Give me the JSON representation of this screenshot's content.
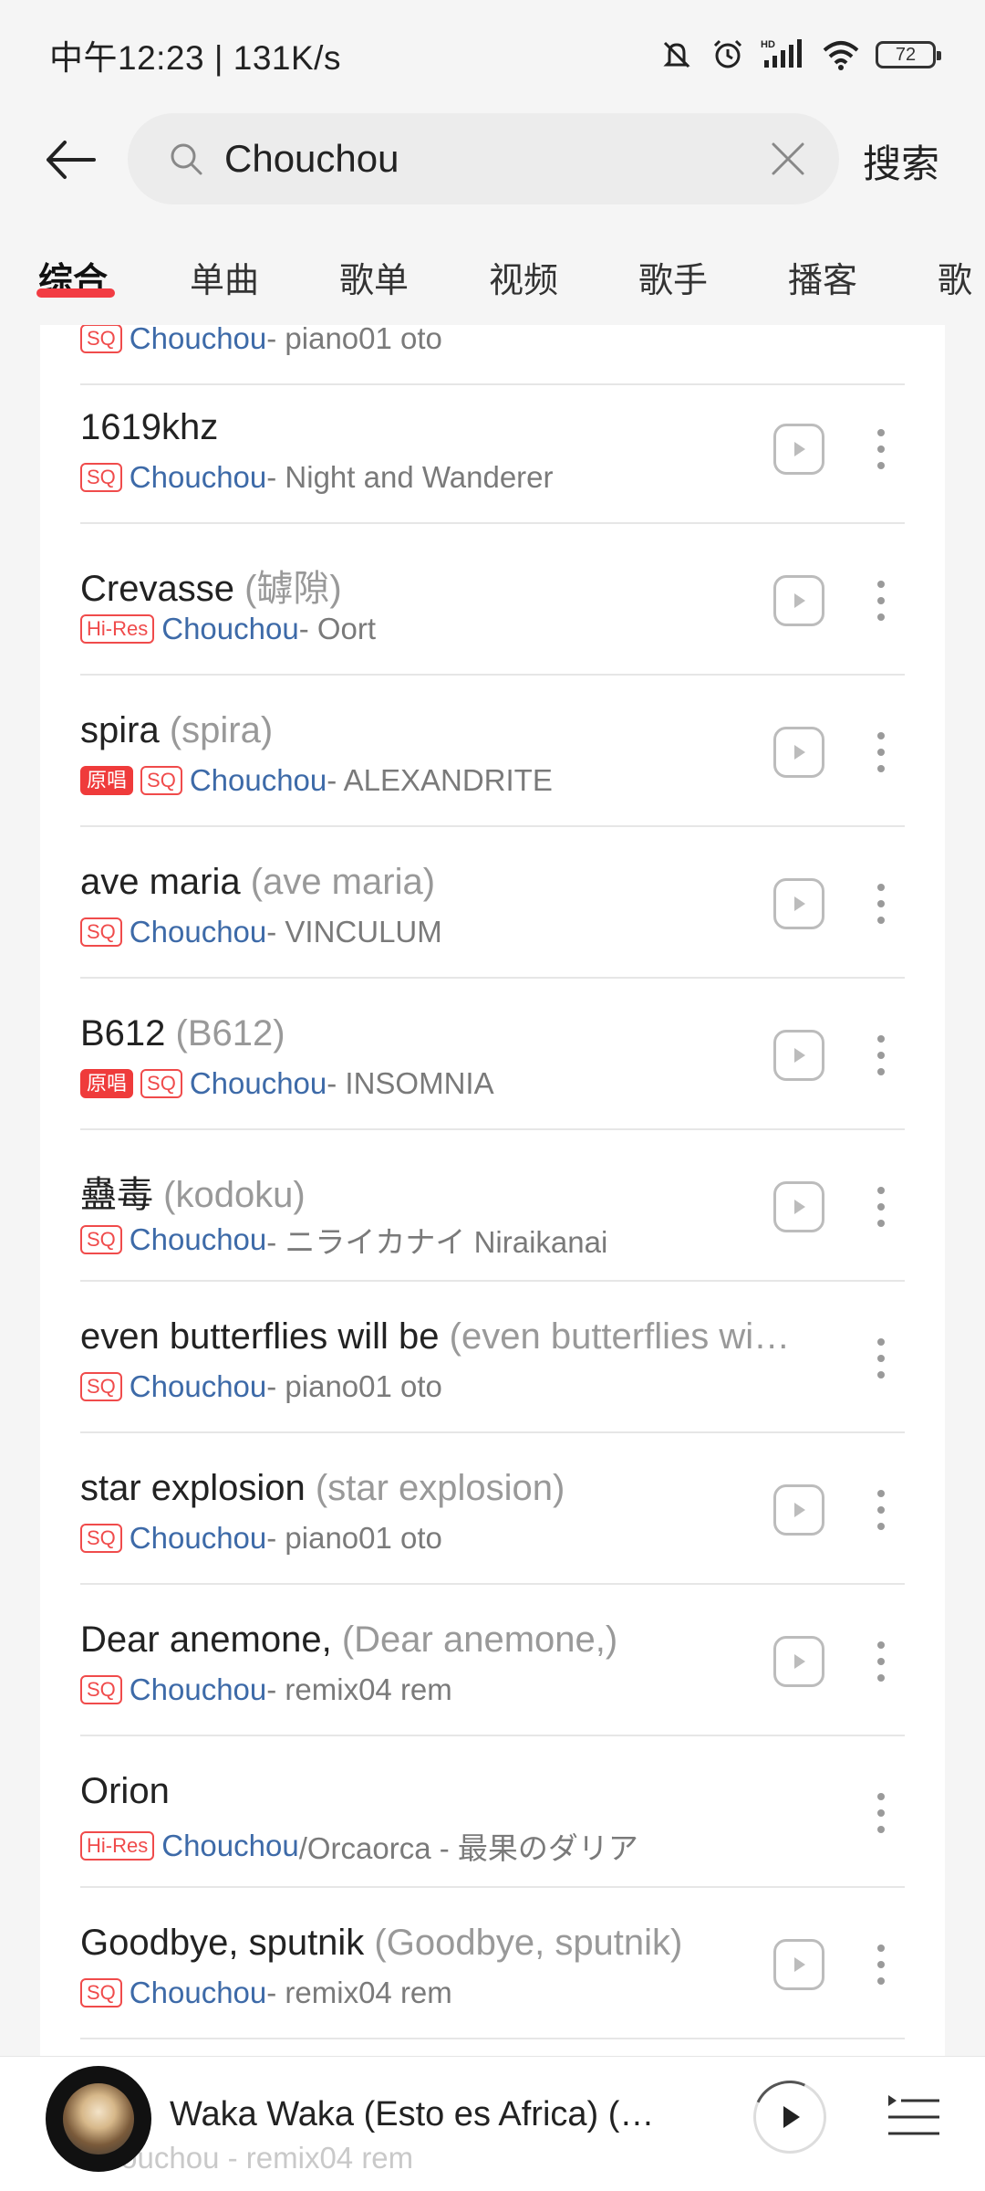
{
  "status_bar": {
    "time_speed": "中午12:23 | 131K/s",
    "battery": "72",
    "icons": [
      "mute-icon",
      "alarm-icon",
      "hd-signal-icon",
      "wifi-icon",
      "battery-icon"
    ]
  },
  "search": {
    "query": "Chouchou",
    "action_label": "搜索"
  },
  "tabs": [
    {
      "label": "综合",
      "active": true
    },
    {
      "label": "单曲",
      "active": false
    },
    {
      "label": "歌单",
      "active": false
    },
    {
      "label": "视频",
      "active": false
    },
    {
      "label": "歌手",
      "active": false
    },
    {
      "label": "播客",
      "active": false
    },
    {
      "label": "歌",
      "active": false
    }
  ],
  "partial_top_row": {
    "badge": "SQ",
    "artist": "Chouchou",
    "album": " - piano01 oto"
  },
  "songs": [
    {
      "title": "1619khz",
      "alias": "",
      "badges": [
        "SQ"
      ],
      "artist": "Chouchou",
      "album": " - Night and Wanderer",
      "has_play": true
    },
    {
      "title": "Crevasse ",
      "alias": "(罅隙)",
      "badges": [
        "Hi-Res"
      ],
      "artist": "Chouchou",
      "album": " - Oort",
      "has_play": true
    },
    {
      "title": "spira ",
      "alias": "(spira)",
      "badges": [
        "原唱",
        "SQ"
      ],
      "artist": "Chouchou",
      "album": " - ALEXANDRITE",
      "has_play": true
    },
    {
      "title": "ave maria ",
      "alias": "(ave maria)",
      "badges": [
        "SQ"
      ],
      "artist": "Chouchou",
      "album": " - VINCULUM",
      "has_play": true
    },
    {
      "title": "B612 ",
      "alias": "(B612)",
      "badges": [
        "原唱",
        "SQ"
      ],
      "artist": "Chouchou",
      "album": " - INSOMNIA",
      "has_play": true
    },
    {
      "title": "蠱毒 ",
      "alias": "(kodoku)",
      "badges": [
        "SQ"
      ],
      "artist": "Chouchou",
      "album": " - ニライカナイ Niraikanai",
      "has_play": true
    },
    {
      "title": "even butterflies will be ",
      "alias": "(even butterflies wi…",
      "badges": [
        "SQ"
      ],
      "artist": "Chouchou",
      "album": " - piano01 oto",
      "has_play": false
    },
    {
      "title": "star explosion ",
      "alias": "(star explosion)",
      "badges": [
        "SQ"
      ],
      "artist": "Chouchou",
      "album": " - piano01 oto",
      "has_play": true
    },
    {
      "title": "Dear anemone, ",
      "alias": "(Dear anemone,)",
      "badges": [
        "SQ"
      ],
      "artist": "Chouchou",
      "album": " - remix04 rem",
      "has_play": true
    },
    {
      "title": "Orion",
      "alias": "",
      "badges": [
        "Hi-Res"
      ],
      "artist": "Chouchou",
      "album": "/Orcaorca - 最果のダリア",
      "has_play": false
    },
    {
      "title": "Goodbye, sputnik ",
      "alias": "(Goodbye, sputnik)",
      "badges": [
        "SQ"
      ],
      "artist": "Chouchou",
      "album": " - remix04 rem",
      "has_play": true
    }
  ],
  "player": {
    "now_playing": "Waka Waka (Esto es Africa) (…",
    "ghost_text": "Chouchou - remix04 rem"
  },
  "colors": {
    "accent": "#f23c43",
    "artist_link": "#3d6aa8",
    "badge_red": "#ef3b3b",
    "background": "#f5f5f5"
  }
}
